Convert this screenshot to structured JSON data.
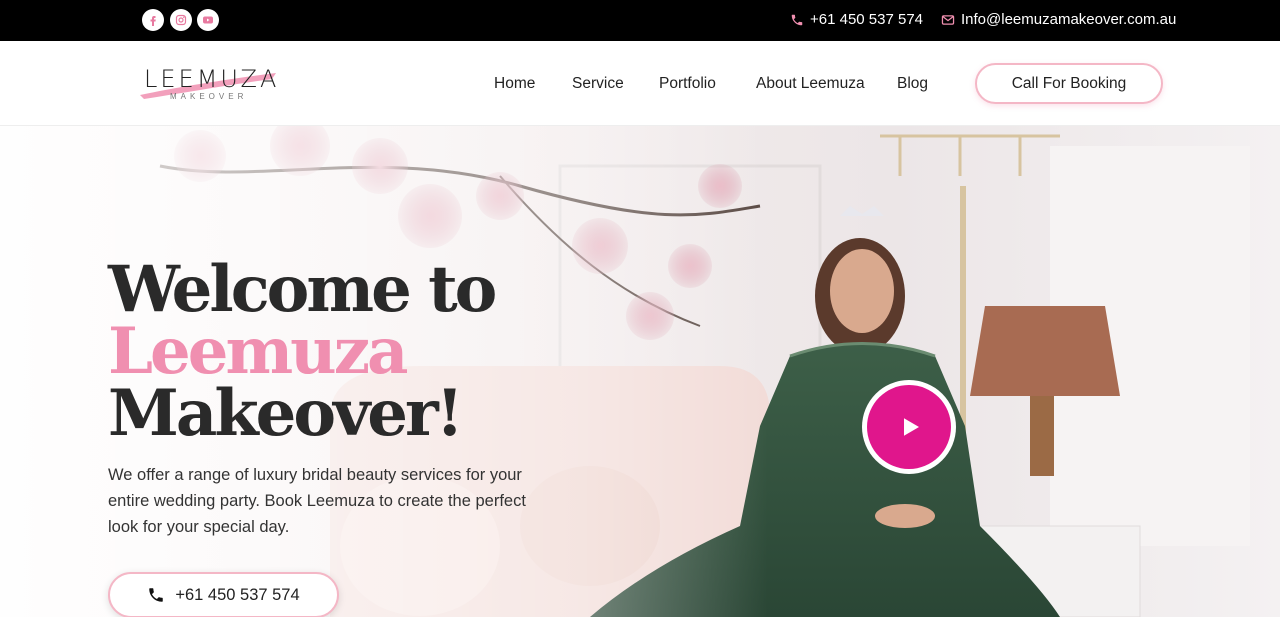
{
  "topbar": {
    "socials": [
      {
        "name": "facebook-icon",
        "color": "#e87aa0"
      },
      {
        "name": "instagram-icon",
        "color": "#e87aa0"
      },
      {
        "name": "youtube-icon",
        "color": "#e87aa0"
      }
    ],
    "phone": "+61 450 537 574",
    "email": "Info@leemuzamakeover.com.au"
  },
  "logo": {
    "word": "LEEMUZA",
    "sub": "MAKEOVER"
  },
  "nav": {
    "items": [
      "Home",
      "Service",
      "Portfolio",
      "About Leemuza",
      "Blog"
    ],
    "cta": "Call For Booking"
  },
  "hero": {
    "line1": "Welcome to",
    "line2": "Leemuza",
    "line3": "Makeover!",
    "description": "We offer a range of luxury bridal beauty services for your entire wedding party. Book Leemuza to create the perfect look for your special day.",
    "phone_button": "+61 450 537 574"
  },
  "colors": {
    "accent_pink": "#f08fb0",
    "play_magenta": "#e0168c",
    "topbar": "#000000"
  }
}
